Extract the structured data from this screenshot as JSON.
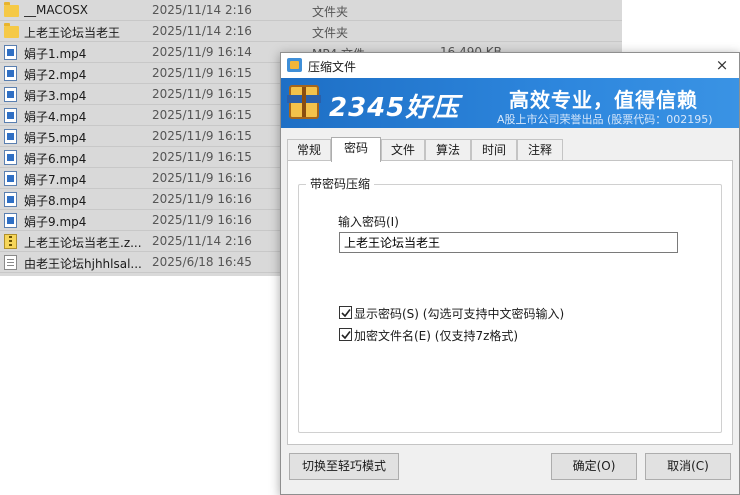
{
  "file_list": {
    "rows": [
      {
        "icon": "folder-icon",
        "name": "__MACOSX",
        "date": "2025/11/14 2:16",
        "type": "文件夹",
        "size": ""
      },
      {
        "icon": "folder-icon",
        "name": "上老王论坛当老王",
        "date": "2025/11/14 2:16",
        "type": "文件夹",
        "size": ""
      },
      {
        "icon": "video-file-icon",
        "name": "娟子1.mp4",
        "date": "2025/11/9 16:14",
        "type": "MP4 文件",
        "size": "16,490 KB"
      },
      {
        "icon": "video-file-icon",
        "name": "娟子2.mp4",
        "date": "2025/11/9 16:15",
        "type": "",
        "size": ""
      },
      {
        "icon": "video-file-icon",
        "name": "娟子3.mp4",
        "date": "2025/11/9 16:15",
        "type": "",
        "size": ""
      },
      {
        "icon": "video-file-icon",
        "name": "娟子4.mp4",
        "date": "2025/11/9 16:15",
        "type": "",
        "size": ""
      },
      {
        "icon": "video-file-icon",
        "name": "娟子5.mp4",
        "date": "2025/11/9 16:15",
        "type": "",
        "size": ""
      },
      {
        "icon": "video-file-icon",
        "name": "娟子6.mp4",
        "date": "2025/11/9 16:15",
        "type": "",
        "size": ""
      },
      {
        "icon": "video-file-icon",
        "name": "娟子7.mp4",
        "date": "2025/11/9 16:16",
        "type": "",
        "size": ""
      },
      {
        "icon": "video-file-icon",
        "name": "娟子8.mp4",
        "date": "2025/11/9 16:16",
        "type": "",
        "size": ""
      },
      {
        "icon": "video-file-icon",
        "name": "娟子9.mp4",
        "date": "2025/11/9 16:16",
        "type": "",
        "size": ""
      },
      {
        "icon": "zip-file-icon",
        "name": "上老王论坛当老王.z...",
        "date": "2025/11/14 2:16",
        "type": "",
        "size": ""
      },
      {
        "icon": "text-file-icon",
        "name": "由老王论坛hjhhlsal...",
        "date": "2025/6/18 16:45",
        "type": "",
        "size": ""
      }
    ]
  },
  "dialog": {
    "title": "压缩文件",
    "close_label": "×",
    "banner": {
      "brand": "2345好压",
      "slogan": "高效专业，值得信赖",
      "subtitle": "A股上市公司荣誉出品 (股票代码：002195)"
    },
    "tabs": [
      "常规",
      "密码",
      "文件",
      "算法",
      "时间",
      "注释"
    ],
    "active_tab": "密码",
    "group_title": "带密码压缩",
    "password_label": "输入密码(I)",
    "password_value": "上老王论坛当老王",
    "show_password": {
      "label": "显示密码(S) (勾选可支持中文密码输入)",
      "checked": true
    },
    "encrypt_filenames": {
      "label": "加密文件名(E) (仅支持7z格式)",
      "checked": true
    },
    "buttons": {
      "switch_mode": "切换至轻巧模式",
      "ok": "确定(O)",
      "cancel": "取消(C)"
    }
  },
  "colors": {
    "banner_blue": "#2d86dd",
    "list_selection": "#d9d9d9",
    "dialog_bg": "#f0f0f0"
  }
}
